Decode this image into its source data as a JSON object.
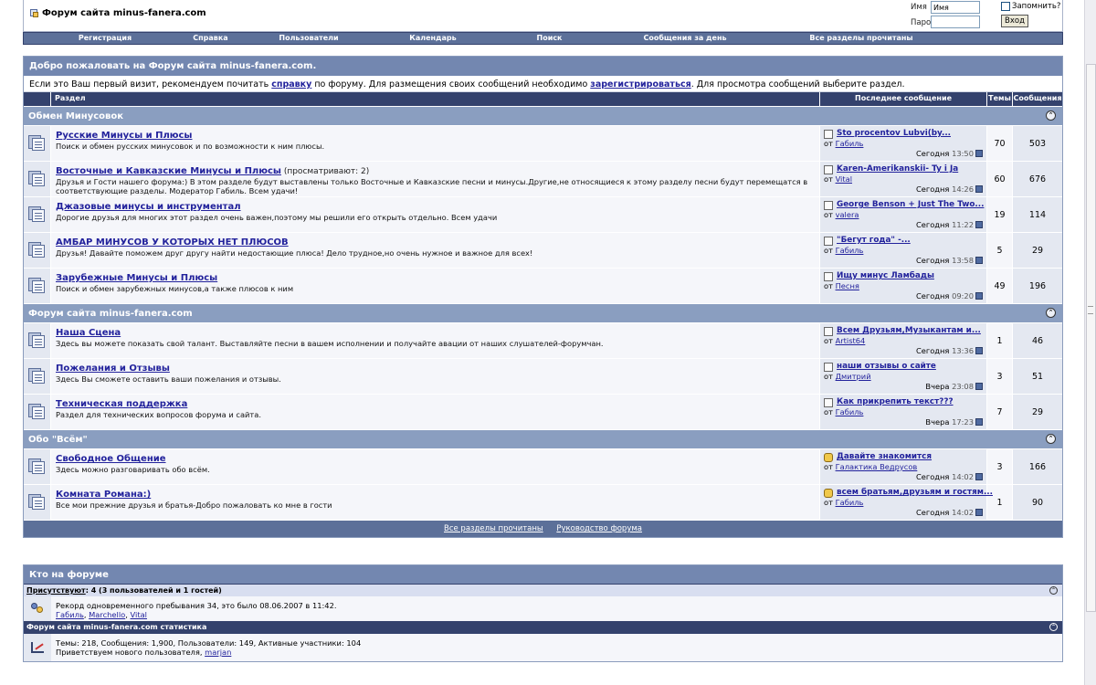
{
  "header": {
    "site_title": "Форум сайта minus-fanera.com",
    "login": {
      "user_label": "Имя",
      "user_value": "Имя",
      "pass_label": "Пароль",
      "remember_label": "Запомнить?",
      "submit_label": "Вход"
    }
  },
  "navbar": [
    "Регистрация",
    "Справка",
    "Пользователи",
    "Календарь",
    "Поиск",
    "Сообщения за день",
    "Все разделы прочитаны"
  ],
  "welcome": {
    "title": "Добро пожаловать на Форум сайта minus-fanera.com.",
    "text_1": "Если это Ваш первый визит, рекомендуем почитать ",
    "link_help": "справку",
    "text_2": " по форуму. Для размещения своих сообщений необходимо ",
    "link_register": "зарегистрироваться",
    "text_3": ". Для просмотра сообщений выберите раздел."
  },
  "table_headers": {
    "forum": "Раздел",
    "last_post": "Последнее сообщение",
    "threads": "Темы",
    "posts": "Сообщения"
  },
  "categories": [
    {
      "title": "Обмен Минусовок",
      "forums": [
        {
          "name": "Русские Минусы и Плюсы",
          "viewing": "",
          "desc": "Поиск и обмен русских минусовок и по возможности к ним плюсы.",
          "last_title": "Sto procentov Lubvi(by...",
          "last_by": "от",
          "last_user": "Габиль",
          "last_day": "Сегодня",
          "last_time": "13:50",
          "threads": "70",
          "posts": "503",
          "icon": "doc"
        },
        {
          "name": "Восточные и Кавказские Минусы и Плюсы",
          "viewing": "(просматривают: 2)",
          "desc": "Друзья и Гости нашего форума:) В этом разделе будут выставлены только Восточные и Кавказские песни и минусы.Другие,не относящиеся к этому разделу песни будут перемещатся в соответствующие разделы. Модератор Габиль. Всем удачи!",
          "last_title": "Karen-Amerikanskii- Ty i Ja",
          "last_by": "от",
          "last_user": "Vital",
          "last_day": "Сегодня",
          "last_time": "14:26",
          "threads": "60",
          "posts": "676",
          "icon": "doc"
        },
        {
          "name": "Джазовые минусы и инструментал",
          "viewing": "",
          "desc": "Дорогие друзья для многих этот раздел очень важен,поэтому мы решили его открыть отдельно. Всем удачи",
          "last_title": "George Benson + Just The Two...",
          "last_by": "от",
          "last_user": "valera",
          "last_day": "Сегодня",
          "last_time": "11:22",
          "threads": "19",
          "posts": "114",
          "icon": "doc"
        },
        {
          "name": "АМБАР МИНУСОВ У КОТОРЫХ НЕТ ПЛЮСОВ",
          "viewing": "",
          "desc": "Друзья! Давайте поможем друг другу найти недостающие плюса! Дело трудное,но очень нужное и важное для всех!",
          "last_title": "\"Бегут года\" -...",
          "last_by": "от",
          "last_user": "Габиль",
          "last_day": "Сегодня",
          "last_time": "13:58",
          "threads": "5",
          "posts": "29",
          "icon": "doc"
        },
        {
          "name": "Зарубежные Минусы и Плюсы",
          "viewing": "",
          "desc": "Поиск и обмен зарубежных минусов,а также плюсов к ним",
          "last_title": "Ищу минус Ламбады",
          "last_by": "от",
          "last_user": "Песня",
          "last_day": "Сегодня",
          "last_time": "09:20",
          "threads": "49",
          "posts": "196",
          "icon": "doc"
        }
      ]
    },
    {
      "title": "Форум сайта minus-fanera.com",
      "forums": [
        {
          "name": "Наша Сцена",
          "viewing": "",
          "desc": "Здесь вы можете показать свой талант. Выставляйте песни в вашем исполнении и получайте авации от наших слушателей-форумчан.",
          "last_title": "Всем Друзьям,Музыкантам и...",
          "last_by": "от",
          "last_user": "Artist64",
          "last_day": "Сегодня",
          "last_time": "13:36",
          "threads": "1",
          "posts": "46",
          "icon": "doc"
        },
        {
          "name": "Пожелания и Отзывы",
          "viewing": "",
          "desc": "Здесь Вы сможете оставить ваши пожелания и отзывы.",
          "last_title": "наши отзывы о сайте",
          "last_by": "от",
          "last_user": "Дмитрий",
          "last_day": "Вчера",
          "last_time": "23:08",
          "threads": "3",
          "posts": "51",
          "icon": "doc"
        },
        {
          "name": "Техническая поддержка",
          "viewing": "",
          "desc": "Раздел для технических вопросов форума и сайта.",
          "last_title": "Как прикрепить текст???",
          "last_by": "от",
          "last_user": "Габиль",
          "last_day": "Вчера",
          "last_time": "17:23",
          "threads": "7",
          "posts": "29",
          "icon": "doc"
        }
      ]
    },
    {
      "title": "Обо \"Всём\"",
      "forums": [
        {
          "name": "Свободное Общение",
          "viewing": "",
          "desc": "Здесь можно разговаривать обо всём.",
          "last_title": "Давайте знакомится",
          "last_by": "от",
          "last_user": "Галактика Ведрусов",
          "last_day": "Сегодня",
          "last_time": "14:02",
          "threads": "3",
          "posts": "166",
          "icon": "thumb"
        },
        {
          "name": "Комната Романа:)",
          "viewing": "",
          "desc": "Все мои прежние друзья и братья-Добро пожаловать ко мне в гости",
          "last_title": "всем братьям,друзьям и гостям...",
          "last_by": "от",
          "last_user": "Габиль",
          "last_day": "Сегодня",
          "last_time": "14:02",
          "threads": "1",
          "posts": "90",
          "icon": "thumb"
        }
      ]
    }
  ],
  "footer_links": [
    "Все разделы прочитаны",
    "Руководство форума"
  ],
  "online": {
    "title": "Кто на форуме",
    "present_label": "Присутствуют",
    "present_text": ": 4 (3 пользователей и 1 гостей)",
    "record_text": "Рекорд одновременного пребывания 34, это было 08.06.2007 в 11:42.",
    "users": [
      "Габиль",
      "Marchello",
      "Vital"
    ],
    "stats_title": "Форум сайта minus-fanera.com статистика",
    "stats_text": "Темы: 218, Сообщения: 1,900, Пользователи: 149, Активные участники: 104",
    "welcome_text": "Приветствуем нового пользователя, ",
    "newest_user": "marjan"
  },
  "colors": {
    "navbar": "#5c7099",
    "header_dark": "#34426d",
    "category": "#8a9ec0",
    "row_alt_1": "#f5f6fa",
    "row_alt_2": "#e4e8f1",
    "link": "#22229c"
  }
}
